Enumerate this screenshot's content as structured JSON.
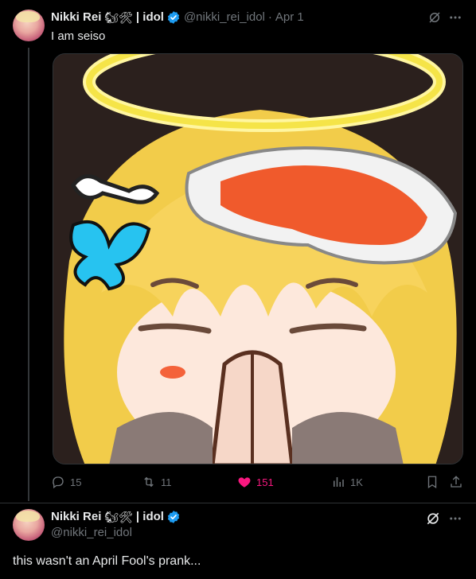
{
  "tweet1": {
    "name": "Nikki Rei",
    "emoji_badges": "🐿🛠",
    "name_suffix": "| idol",
    "handle": "@nikki_rei_idol",
    "separator_dot": "·",
    "date": "Apr 1",
    "text": "I am seiso",
    "image_icon": "anime-angel-praying-emote",
    "stats": {
      "replies": "15",
      "reposts": "11",
      "likes": "151",
      "views": "1K"
    }
  },
  "tweet2": {
    "name": "Nikki Rei",
    "emoji_badges": "🐿🛠",
    "name_suffix": "| idol",
    "handle": "@nikki_rei_idol",
    "text": "this wasn't an April Fool's prank..."
  },
  "colors": {
    "background": "#000000",
    "text_primary": "#e7e9ea",
    "text_secondary": "#71767b",
    "verified_blue": "#1d9bf0",
    "like_pink": "#f91880",
    "divider": "#2f3336"
  }
}
